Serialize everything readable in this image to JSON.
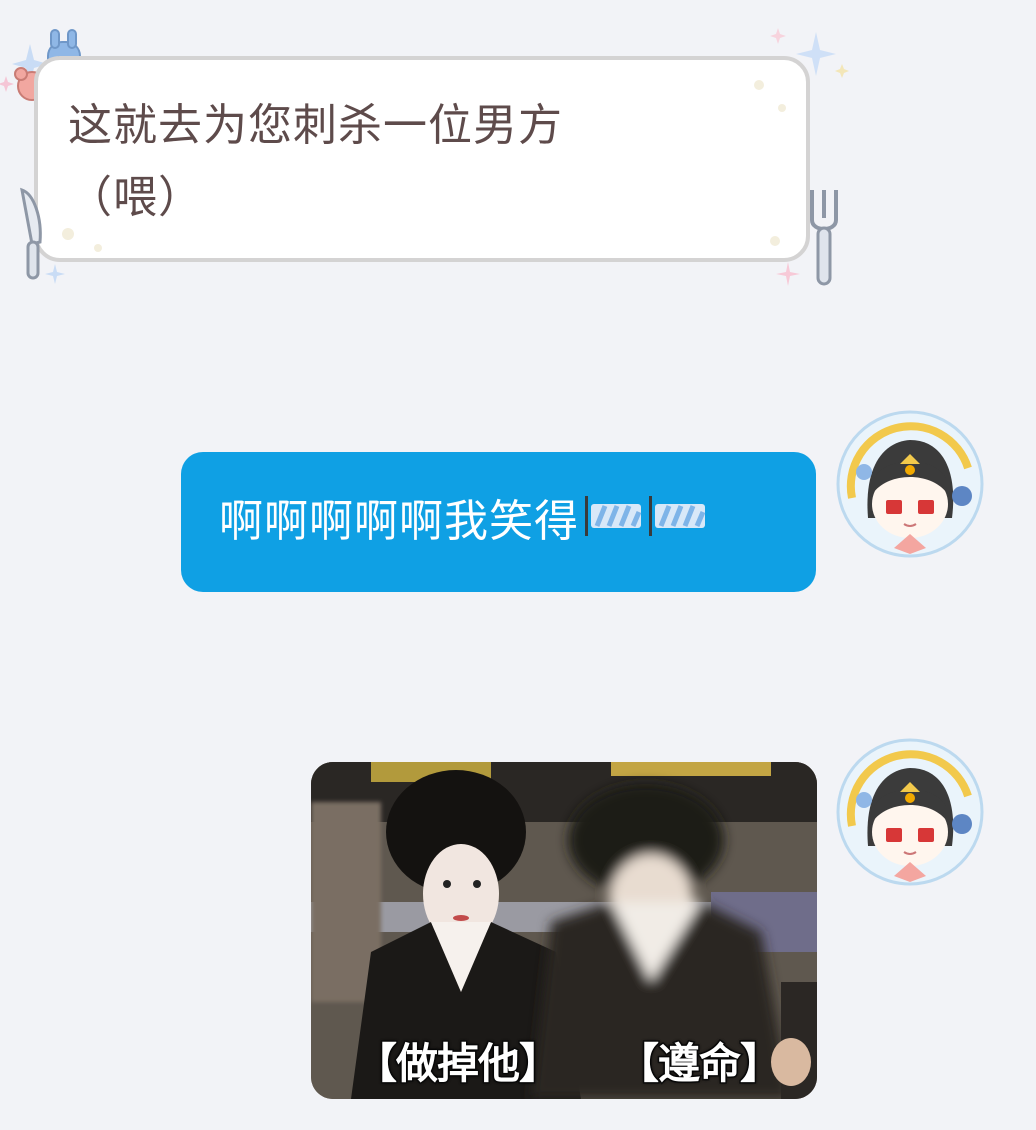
{
  "messages": {
    "incoming": {
      "line1": "这就去为您刺杀一位男方",
      "line2": "（喂）"
    },
    "outgoing_text": {
      "text": "啊啊啊啊啊我笑得",
      "emoji": "blush-icon"
    },
    "outgoing_image": {
      "caption_left": "【做掉他】",
      "caption_right": "【遵命】"
    }
  },
  "colors": {
    "background": "#f2f3f7",
    "outgoing_bubble": "#0fa0e4",
    "incoming_text": "#5e4b4b"
  }
}
